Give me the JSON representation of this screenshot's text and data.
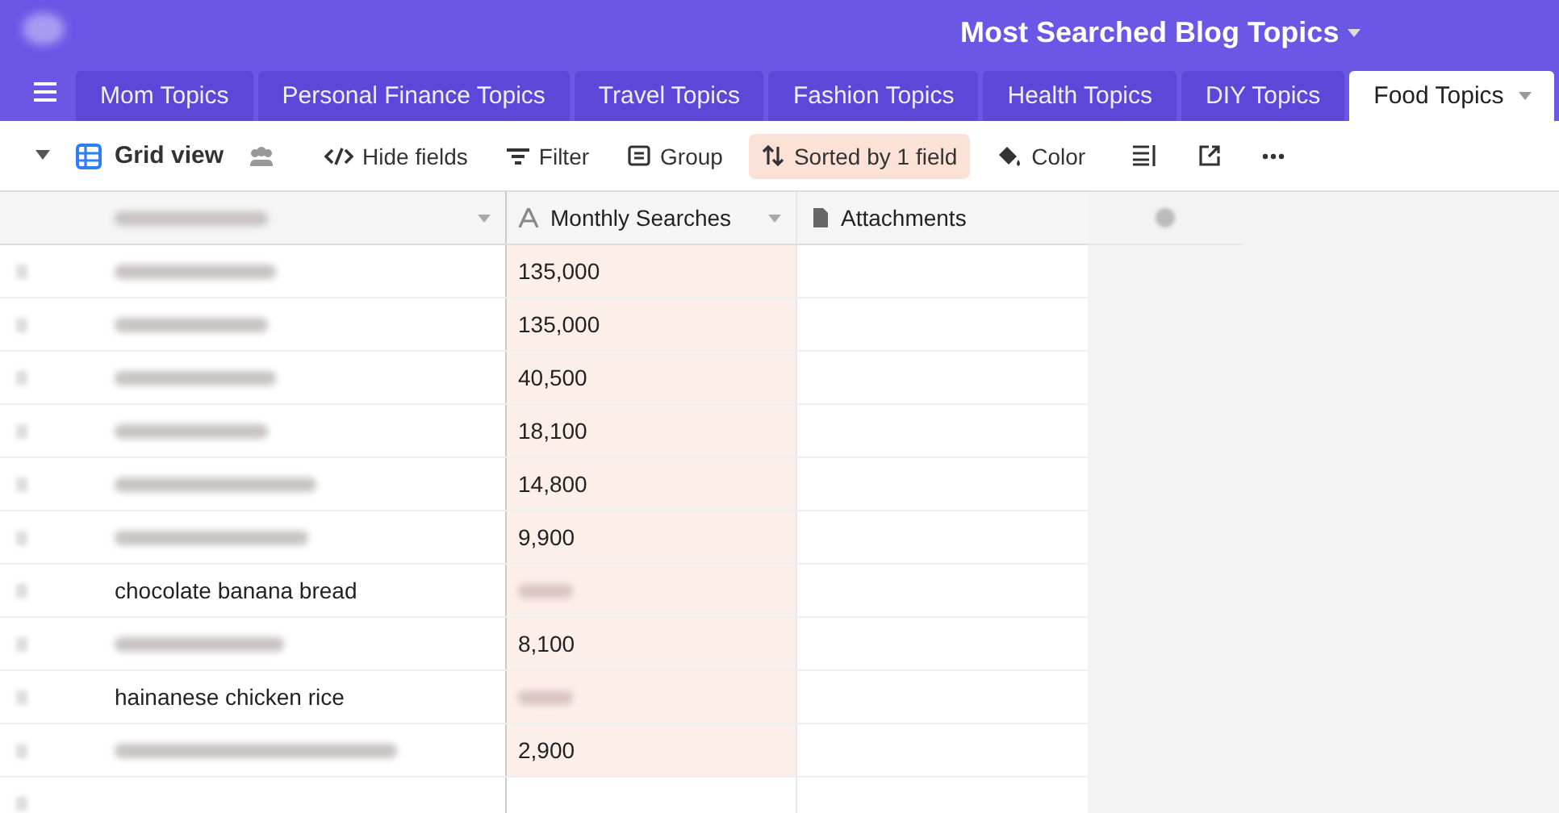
{
  "base": {
    "title": "Most Searched Blog Topics"
  },
  "tabs": [
    {
      "label": "Mom Topics",
      "selected": false
    },
    {
      "label": "Personal Finance Topics",
      "selected": false
    },
    {
      "label": "Travel Topics",
      "selected": false
    },
    {
      "label": "Fashion Topics",
      "selected": false
    },
    {
      "label": "Health Topics",
      "selected": false
    },
    {
      "label": "DIY Topics",
      "selected": false
    },
    {
      "label": "Food Topics",
      "selected": true
    }
  ],
  "toolbar": {
    "view": "Grid view",
    "buttons": [
      {
        "kind": "hide",
        "label": "Hide fields",
        "active": false
      },
      {
        "kind": "filter",
        "label": "Filter",
        "active": false
      },
      {
        "kind": "group",
        "label": "Group",
        "active": false
      },
      {
        "kind": "sort",
        "label": "Sorted by 1 field",
        "active": true
      },
      {
        "kind": "color",
        "label": "Color",
        "active": false
      }
    ]
  },
  "table": {
    "columns": [
      {
        "kind": "blurred"
      },
      {
        "kind": "text",
        "label": "Monthly Searches"
      },
      {
        "kind": "attachment",
        "label": "Attachments"
      }
    ],
    "rows": [
      {
        "searches": "135,000"
      },
      {
        "searches": "135,000"
      },
      {
        "searches": "40,500"
      },
      {
        "searches": "18,100"
      },
      {
        "searches": "14,800"
      },
      {
        "searches": "9,900"
      },
      {
        "name": "chocolate banana bread"
      },
      {
        "searches": "8,100"
      },
      {
        "name": "hainanese chicken rice"
      },
      {
        "searches": "2,900"
      }
    ]
  }
}
